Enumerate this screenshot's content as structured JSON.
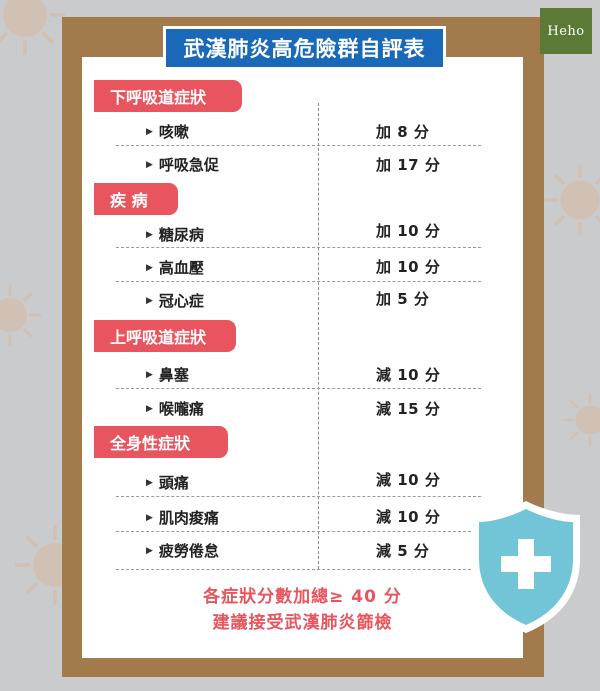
{
  "title": "武漢肺炎高危險群自評表",
  "logo": "Heho",
  "categories": [
    {
      "label": "下呼吸道症狀"
    },
    {
      "label": "疾 病"
    },
    {
      "label": "上呼吸道症狀"
    },
    {
      "label": "全身性症狀"
    }
  ],
  "rows": [
    {
      "item": "咳嗽",
      "score": "加 8 分"
    },
    {
      "item": "呼吸急促",
      "score": "加 17 分"
    },
    {
      "item": "糖尿病",
      "score": "加 10 分"
    },
    {
      "item": "高血壓",
      "score": "加 10 分"
    },
    {
      "item": "冠心症",
      "score": "加 5 分"
    },
    {
      "item": "鼻塞",
      "score": "減 10 分"
    },
    {
      "item": "喉嚨痛",
      "score": "減 15 分"
    },
    {
      "item": "頭痛",
      "score": "減 10 分"
    },
    {
      "item": "肌肉痠痛",
      "score": "減 10 分"
    },
    {
      "item": "疲勞倦怠",
      "score": "減 5 分"
    }
  ],
  "footer": {
    "line1": "各症狀分數加總≥ 40 分",
    "line2": "建議接受武漢肺炎篩檢"
  },
  "colors": {
    "accent": "#e8555e",
    "title_bg": "#1a68b8",
    "board": "#a27a4c",
    "shield": "#72c5d6",
    "logo_bg": "#5c7a36"
  }
}
